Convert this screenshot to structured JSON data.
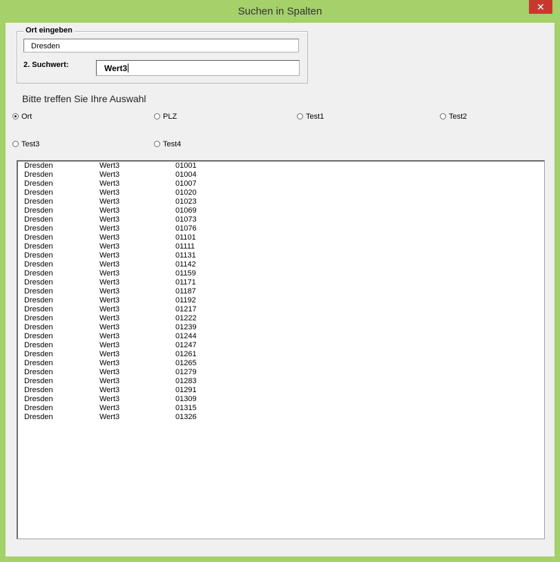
{
  "window": {
    "title": "Suchen in Spalten",
    "close_glyph": "✕"
  },
  "group": {
    "legend": "Ort eingeben",
    "ort_value": "Dresden"
  },
  "suchwert": {
    "label": "2. Suchwert:",
    "value": "Wert3"
  },
  "prompt": "Bitte treffen Sie Ihre Auswahl",
  "radios": [
    {
      "label": "Ort",
      "selected": true
    },
    {
      "label": "PLZ",
      "selected": false
    },
    {
      "label": "Test1",
      "selected": false
    },
    {
      "label": "Test2",
      "selected": false
    },
    {
      "label": "Test3",
      "selected": false
    },
    {
      "label": "Test4",
      "selected": false
    }
  ],
  "results": [
    [
      "Dresden",
      "Wert3",
      "01001"
    ],
    [
      "Dresden",
      "Wert3",
      "01004"
    ],
    [
      "Dresden",
      "Wert3",
      "01007"
    ],
    [
      "Dresden",
      "Wert3",
      "01020"
    ],
    [
      "Dresden",
      "Wert3",
      "01023"
    ],
    [
      "Dresden",
      "Wert3",
      "01069"
    ],
    [
      "Dresden",
      "Wert3",
      "01073"
    ],
    [
      "Dresden",
      "Wert3",
      "01076"
    ],
    [
      "Dresden",
      "Wert3",
      "01101"
    ],
    [
      "Dresden",
      "Wert3",
      "01111"
    ],
    [
      "Dresden",
      "Wert3",
      "01131"
    ],
    [
      "Dresden",
      "Wert3",
      "01142"
    ],
    [
      "Dresden",
      "Wert3",
      "01159"
    ],
    [
      "Dresden",
      "Wert3",
      "01171"
    ],
    [
      "Dresden",
      "Wert3",
      "01187"
    ],
    [
      "Dresden",
      "Wert3",
      "01192"
    ],
    [
      "Dresden",
      "Wert3",
      "01217"
    ],
    [
      "Dresden",
      "Wert3",
      "01222"
    ],
    [
      "Dresden",
      "Wert3",
      "01239"
    ],
    [
      "Dresden",
      "Wert3",
      "01244"
    ],
    [
      "Dresden",
      "Wert3",
      "01247"
    ],
    [
      "Dresden",
      "Wert3",
      "01261"
    ],
    [
      "Dresden",
      "Wert3",
      "01265"
    ],
    [
      "Dresden",
      "Wert3",
      "01279"
    ],
    [
      "Dresden",
      "Wert3",
      "01283"
    ],
    [
      "Dresden",
      "Wert3",
      "01291"
    ],
    [
      "Dresden",
      "Wert3",
      "01309"
    ],
    [
      "Dresden",
      "Wert3",
      "01315"
    ],
    [
      "Dresden",
      "Wert3",
      "01326"
    ]
  ]
}
